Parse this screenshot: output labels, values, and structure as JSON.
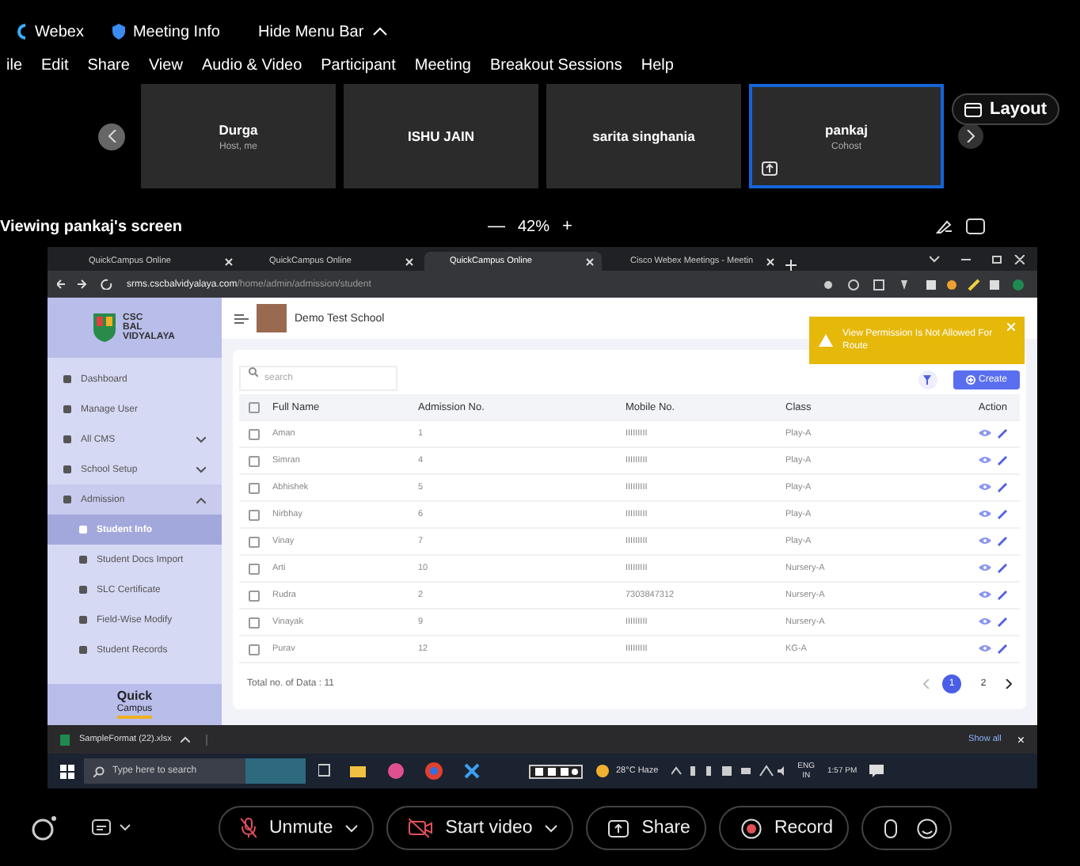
{
  "webex_bar": {
    "app": "Webex",
    "meeting_info": "Meeting Info",
    "hide_menu": "Hide Menu Bar"
  },
  "menu": [
    "ile",
    "Edit",
    "Share",
    "View",
    "Audio & Video",
    "Participant",
    "Meeting",
    "Breakout Sessions",
    "Help"
  ],
  "participants": [
    {
      "name": "Durga",
      "role": "Host, me",
      "selected": false
    },
    {
      "name": "ISHU JAIN",
      "selected": false
    },
    {
      "name": "sarita singhania",
      "selected": false
    },
    {
      "name": "pankaj",
      "role": "Cohost",
      "selected": true
    }
  ],
  "layout_button": "Layout",
  "viewing": "Viewing pankaj's screen",
  "zoom": {
    "minus": "—",
    "value": "42%",
    "plus": "+"
  },
  "browser": {
    "tabs": [
      {
        "title": "QuickCampus Online",
        "selected": false
      },
      {
        "title": "QuickCampus Online",
        "selected": false
      },
      {
        "title": "QuickCampus Online",
        "selected": true
      },
      {
        "title": "Cisco Webex Meetings - Meetin",
        "selected": false
      }
    ],
    "url_host": "srms.cscbalvidyalaya.com",
    "url_path": "/home/admin/admission/student"
  },
  "app": {
    "logo": [
      "CSC",
      "BAL",
      "VIDYALAYA"
    ],
    "school": "Demo Test School",
    "toast": "View Permission Is Not Allowed For Route",
    "sidebar": [
      {
        "label": "Dashboard"
      },
      {
        "label": "Manage User"
      },
      {
        "label": "All CMS",
        "expanded": false
      },
      {
        "label": "School Setup",
        "expanded": false
      },
      {
        "label": "Admission",
        "expanded": true,
        "children": [
          {
            "label": "Student Info",
            "selected": true
          },
          {
            "label": "Student Docs Import",
            "selected": false
          },
          {
            "label": "SLC Certificate",
            "selected": false
          },
          {
            "label": "Field-Wise Modify",
            "selected": false
          },
          {
            "label": "Student Records",
            "selected": false
          }
        ]
      }
    ],
    "footer_logo": [
      "Quick",
      "Campus"
    ],
    "search_placeholder": "search",
    "create": "Create",
    "select_all_checked": false,
    "columns": [
      "Full Name",
      "Admission No.",
      "Mobile No.",
      "Class",
      "Action"
    ],
    "rows": [
      {
        "name": "Aman",
        "admission": "1",
        "mobile": "IIIIIIIII",
        "class": "Play-A",
        "checked": false
      },
      {
        "name": "Simran",
        "admission": "4",
        "mobile": "IIIIIIIII",
        "class": "Play-A",
        "checked": false
      },
      {
        "name": "Abhishek",
        "admission": "5",
        "mobile": "IIIIIIIII",
        "class": "Play-A",
        "checked": false
      },
      {
        "name": "Nirbhay",
        "admission": "6",
        "mobile": "IIIIIIIII",
        "class": "Play-A",
        "checked": false
      },
      {
        "name": "Vinay",
        "admission": "7",
        "mobile": "IIIIIIIII",
        "class": "Play-A",
        "checked": false
      },
      {
        "name": "Arti",
        "admission": "10",
        "mobile": "IIIIIIIII",
        "class": "Nursery-A",
        "checked": false
      },
      {
        "name": "Rudra",
        "admission": "2",
        "mobile": "7303847312",
        "class": "Nursery-A",
        "checked": false
      },
      {
        "name": "Vinayak",
        "admission": "9",
        "mobile": "IIIIIIIII",
        "class": "Nursery-A",
        "checked": false
      },
      {
        "name": "Purav",
        "admission": "12",
        "mobile": "IIIIIIIII",
        "class": "KG-A",
        "checked": false
      }
    ],
    "total": "Total no. of Data : 11",
    "pages": [
      {
        "label": "1",
        "selected": true
      },
      {
        "label": "2",
        "selected": false
      }
    ]
  },
  "download": {
    "file": "SampleFormat (22).xlsx",
    "show_all": "Show all",
    "close": "×"
  },
  "taskbar": {
    "search_placeholder": "Type here to search",
    "weather": "28°C Haze",
    "lang": "ENG",
    "region": "IN",
    "time": "1:57 PM"
  },
  "controls": [
    {
      "kind": "mute",
      "label": "Unmute"
    },
    {
      "kind": "video",
      "label": "Start video"
    },
    {
      "kind": "share",
      "label": "Share"
    },
    {
      "kind": "record",
      "label": "Record"
    }
  ]
}
